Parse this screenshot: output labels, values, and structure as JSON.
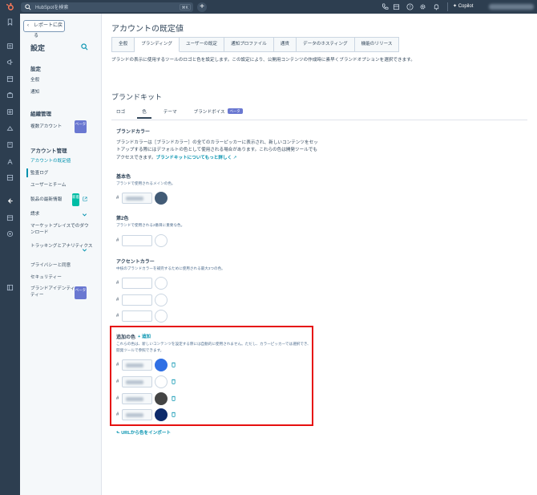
{
  "topbar": {
    "search_placeholder": "HubSpotを検索",
    "search_shortcut": "⌘K",
    "add_label": "+",
    "copilot_label": "Copilot"
  },
  "settings_nav": {
    "back_label": "レポートに戻る",
    "title": "設定",
    "sections": {
      "settings_h": "設定",
      "general": "全般",
      "notifications": "通知",
      "org_h": "組織管理",
      "multi_account": "複数アカウント",
      "account_h": "アカウント管理",
      "account_defaults": "アカウントの既定値",
      "audit_log": "監査ログ",
      "users_teams": "ユーザーとチーム",
      "product_updates": "製品の最新情報",
      "billing": "請求",
      "marketplace": "マーケットプレイスでのダウンロード",
      "tracking": "トラッキングとアナリティクス",
      "privacy": "プライバシーと同意",
      "security": "セキュリティー",
      "brand_identity": "ブランドアイデンティティー"
    },
    "beta_badge": "ベータ",
    "new_badge": "新着"
  },
  "main": {
    "page_title": "アカウントの既定値",
    "tabs": [
      "全般",
      "ブランディング",
      "ユーザーの既定",
      "通知プロファイル",
      "通貨",
      "データのホスティング",
      "機能のリリース"
    ],
    "active_tab": 1,
    "description": "ブランドの表示に使用するツールのロゴと色を設定します。この設定により、公開用コンテンツの作成時に素早くブランドオプションを選択できます。",
    "brand_kit_title": "ブランドキット",
    "subtabs": [
      "ロゴ",
      "色",
      "テーマ",
      "ブランドボイス"
    ],
    "subtab_beta": "ベータ",
    "brand_colors_h": "ブランドカラー",
    "brand_colors_desc": "ブランドカラーは［ブランドカラー］の全てのカラーピッカーに表示され、新しいコンテンツをセットアップする際にはデフォルトの色として使用される場合があります。これらの色は開発ツールでもアクセスできます。",
    "brand_colors_link": "ブランドキットについてもっと詳しく",
    "primary_h": "基本色",
    "primary_sub": "ブランドで使用されるメインの色。",
    "secondary_h": "第2色",
    "secondary_sub": "ブランドで使用される2番目に重要な色。",
    "accent_h": "アクセントカラー",
    "accent_sub": "中核のブランドカラーを補完するために使用される最大3つの色。",
    "additional_h": "追加の色",
    "add_link": "+ 追加",
    "additional_desc": "これらの色は、新しいコンテンツを設定する際には自動的に使用されません。ただし、カラーピッカーでは選択でき、開発ツールで参照できます。",
    "hash": "#",
    "import_link": "URLから色をインポート"
  },
  "colors": {
    "primary": "#425b76",
    "additional": [
      "#2f6fe4",
      "#ffffff",
      "#444444",
      "#0d2a6b"
    ],
    "accent": "#0091ae",
    "highlight": "#e6100f"
  }
}
